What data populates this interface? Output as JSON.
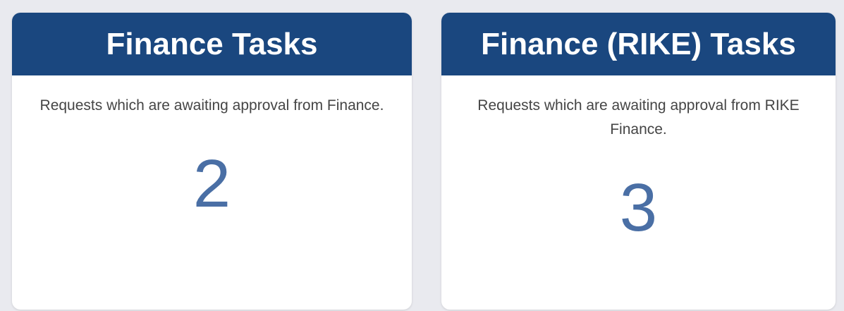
{
  "cards": [
    {
      "title": "Finance Tasks",
      "description": "Requests which are awaiting approval from Finance.",
      "count": "2"
    },
    {
      "title": "Finance (RIKE) Tasks",
      "description": "Requests which are awaiting approval from RIKE Finance.",
      "count": "3"
    }
  ],
  "colors": {
    "header_bg": "#1a477f",
    "count_text": "#4a6fa5",
    "page_bg": "#e9eaef"
  }
}
